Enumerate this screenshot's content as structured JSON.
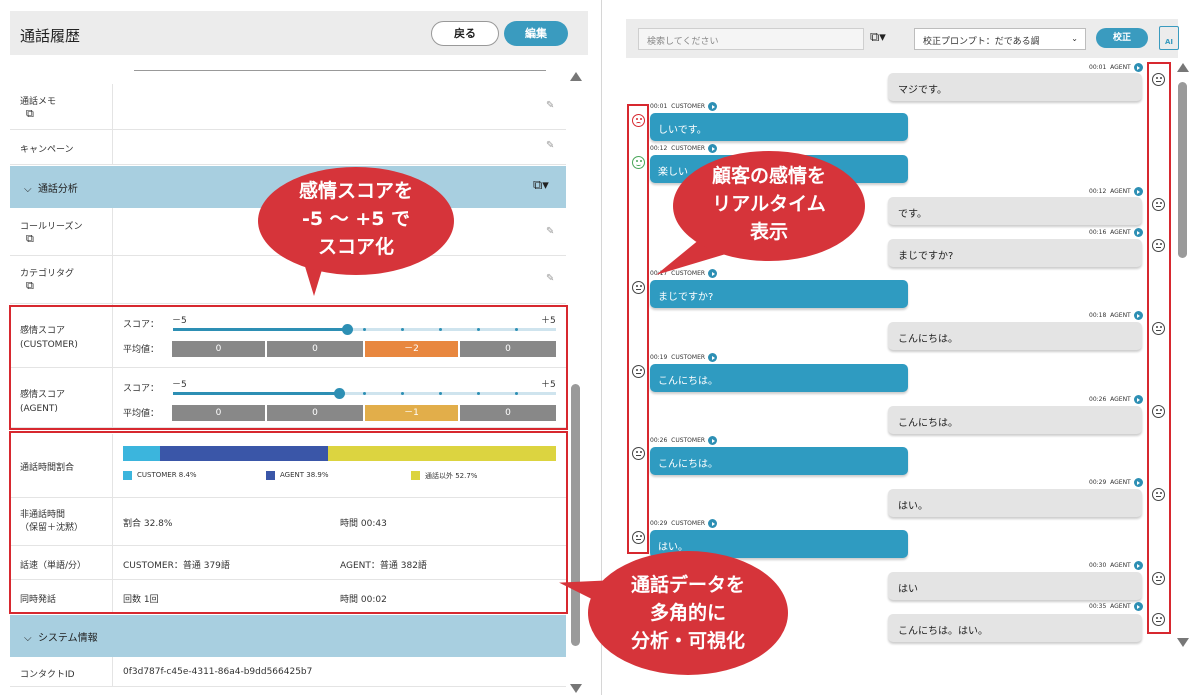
{
  "left": {
    "title": "通話履歴",
    "back_label": "戻る",
    "edit_label": "編集",
    "rows": {
      "memo": "通話メモ",
      "campaign": "キャンペーン",
      "call_reason": "コールリーズン",
      "category_tag": "カテゴリタグ"
    },
    "section_analysis": "通話分析",
    "section_system": "システム情報",
    "sentiment": {
      "customer": {
        "label_line1": "感情スコア",
        "label_line2": "(CUSTOMER)",
        "score_label": "スコア：",
        "min_label": "－5",
        "max_label": "＋5",
        "score": 0,
        "avg_label": "平均値：",
        "avg_values": [
          "0",
          "0",
          "－2",
          "0"
        ]
      },
      "agent": {
        "label_line1": "感情スコア",
        "label_line2": "(AGENT)",
        "score_label": "スコア：",
        "min_label": "－5",
        "max_label": "＋5",
        "score": -1,
        "avg_label": "平均値：",
        "avg_values": [
          "0",
          "0",
          "－1",
          "0"
        ]
      }
    },
    "talk_ratio": {
      "label": "通話時間割合",
      "customer_pct": 8.4,
      "agent_pct": 38.9,
      "other_pct": 52.7,
      "legend_customer": "CUSTOMER 8.4%",
      "legend_agent": "AGENT 38.9%",
      "legend_other": "通話以外 52.7%",
      "colors": {
        "customer": "#3bb5dd",
        "agent": "#3a56a8",
        "other": "#dcd440"
      }
    },
    "non_talk": {
      "label_line1": "非通話時間",
      "label_line2": "（保留＋沈黙）",
      "ratio": "割合 32.8%",
      "time": "時間 00:43"
    },
    "speed": {
      "label": "話速（単語/分）",
      "customer": "CUSTOMER：普通 379語",
      "agent": "AGENT：普通 382語"
    },
    "overlap": {
      "label": "同時発話",
      "count": "回数 1回",
      "time": "時間 00:02"
    },
    "contact": {
      "label": "コンタクトID",
      "value": "0f3d787f-c45e-4311-86a4-b9dd566425b7"
    }
  },
  "right": {
    "search_placeholder": "検索してください",
    "prompt_value": "校正プロンプト：だである調",
    "fix_label": "校正",
    "ai_label": "AI",
    "messages": [
      {
        "speaker": "AGENT",
        "time": "00:01",
        "text": "マジです。",
        "face": "neutral"
      },
      {
        "speaker": "CUSTOMER",
        "time": "00:01",
        "text": "しいです。",
        "face": "sad"
      },
      {
        "speaker": "CUSTOMER",
        "time": "00:12",
        "text": "楽しい",
        "face": "happy"
      },
      {
        "speaker": "AGENT",
        "time": "00:12",
        "text": "です。",
        "face": "neutral"
      },
      {
        "speaker": "AGENT",
        "time": "00:16",
        "text": "まじですか?",
        "face": "neutral"
      },
      {
        "speaker": "CUSTOMER",
        "time": "00:17",
        "text": "まじですか?",
        "face": "neutral"
      },
      {
        "speaker": "AGENT",
        "time": "00:18",
        "text": "こんにちは。",
        "face": "neutral"
      },
      {
        "speaker": "CUSTOMER",
        "time": "00:19",
        "text": "こんにちは。",
        "face": "neutral"
      },
      {
        "speaker": "AGENT",
        "time": "00:26",
        "text": "こんにちは。",
        "face": "neutral"
      },
      {
        "speaker": "CUSTOMER",
        "time": "00:26",
        "text": "こんにちは。",
        "face": "neutral"
      },
      {
        "speaker": "AGENT",
        "time": "00:29",
        "text": "はい。",
        "face": "neutral"
      },
      {
        "speaker": "CUSTOMER",
        "time": "00:29",
        "text": "はい。",
        "face": "neutral"
      },
      {
        "speaker": "AGENT",
        "time": "00:30",
        "text": "はい",
        "face": "neutral"
      },
      {
        "speaker": "AGENT",
        "time": "00:35",
        "text": "こんにちは。はい。",
        "face": "neutral"
      }
    ]
  },
  "callouts": {
    "score": [
      "感情スコアを",
      "-5 ～ +5 で",
      "スコア化"
    ],
    "realtime": [
      "顧客の感情を",
      "リアルタイム",
      "表示"
    ],
    "analysis": [
      "通話データを",
      "多角的に",
      "分析・可視化"
    ]
  },
  "colors": {
    "accent": "#3a9bbf",
    "customer_bubble": "#2f9bc1",
    "agent_bubble": "#e4e4e4",
    "section_bg": "#a8cfe0",
    "highlight_red": "#d7282f",
    "avg_negative_customer": "#e8873f",
    "avg_negative_agent": "#e2ae4a",
    "avg_neutral": "#888888"
  },
  "icons": [
    "copy-icon",
    "pencil-icon",
    "chevron-down-icon",
    "play-icon",
    "face-icon",
    "ai-icon",
    "scroll-up-icon",
    "scroll-down-icon"
  ]
}
